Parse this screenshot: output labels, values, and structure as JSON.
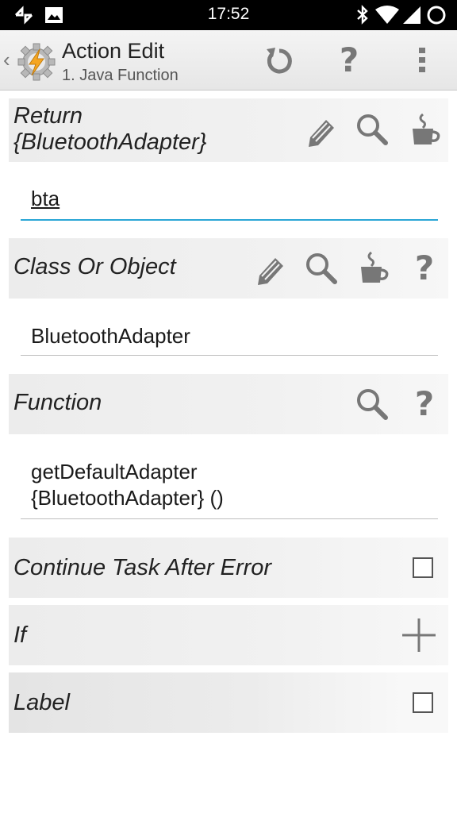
{
  "status_bar": {
    "time": "17:52"
  },
  "action_bar": {
    "back_glyph": "‹",
    "title": "Action Edit",
    "subtitle": "1. Java Function",
    "buttons": [
      "reset-icon",
      "help-icon",
      "overflow-menu-icon"
    ]
  },
  "return_section": {
    "label_line1": "Return",
    "label_line2": "{BluetoothAdapter}",
    "value": "bta"
  },
  "class_section": {
    "label": "Class Or Object",
    "value": "BluetoothAdapter"
  },
  "function_section": {
    "label": "Function",
    "value_line1": "getDefaultAdapter",
    "value_line2": "{BluetoothAdapter} ()"
  },
  "continue_row": {
    "label": "Continue Task After Error",
    "checked": false
  },
  "if_row": {
    "label": "If"
  },
  "label_row": {
    "label": "Label",
    "checked": false
  },
  "colors": {
    "accent": "#2aa6d6",
    "icon_gray": "#777777",
    "section_bg": "#ececec"
  },
  "help_glyph": "?"
}
